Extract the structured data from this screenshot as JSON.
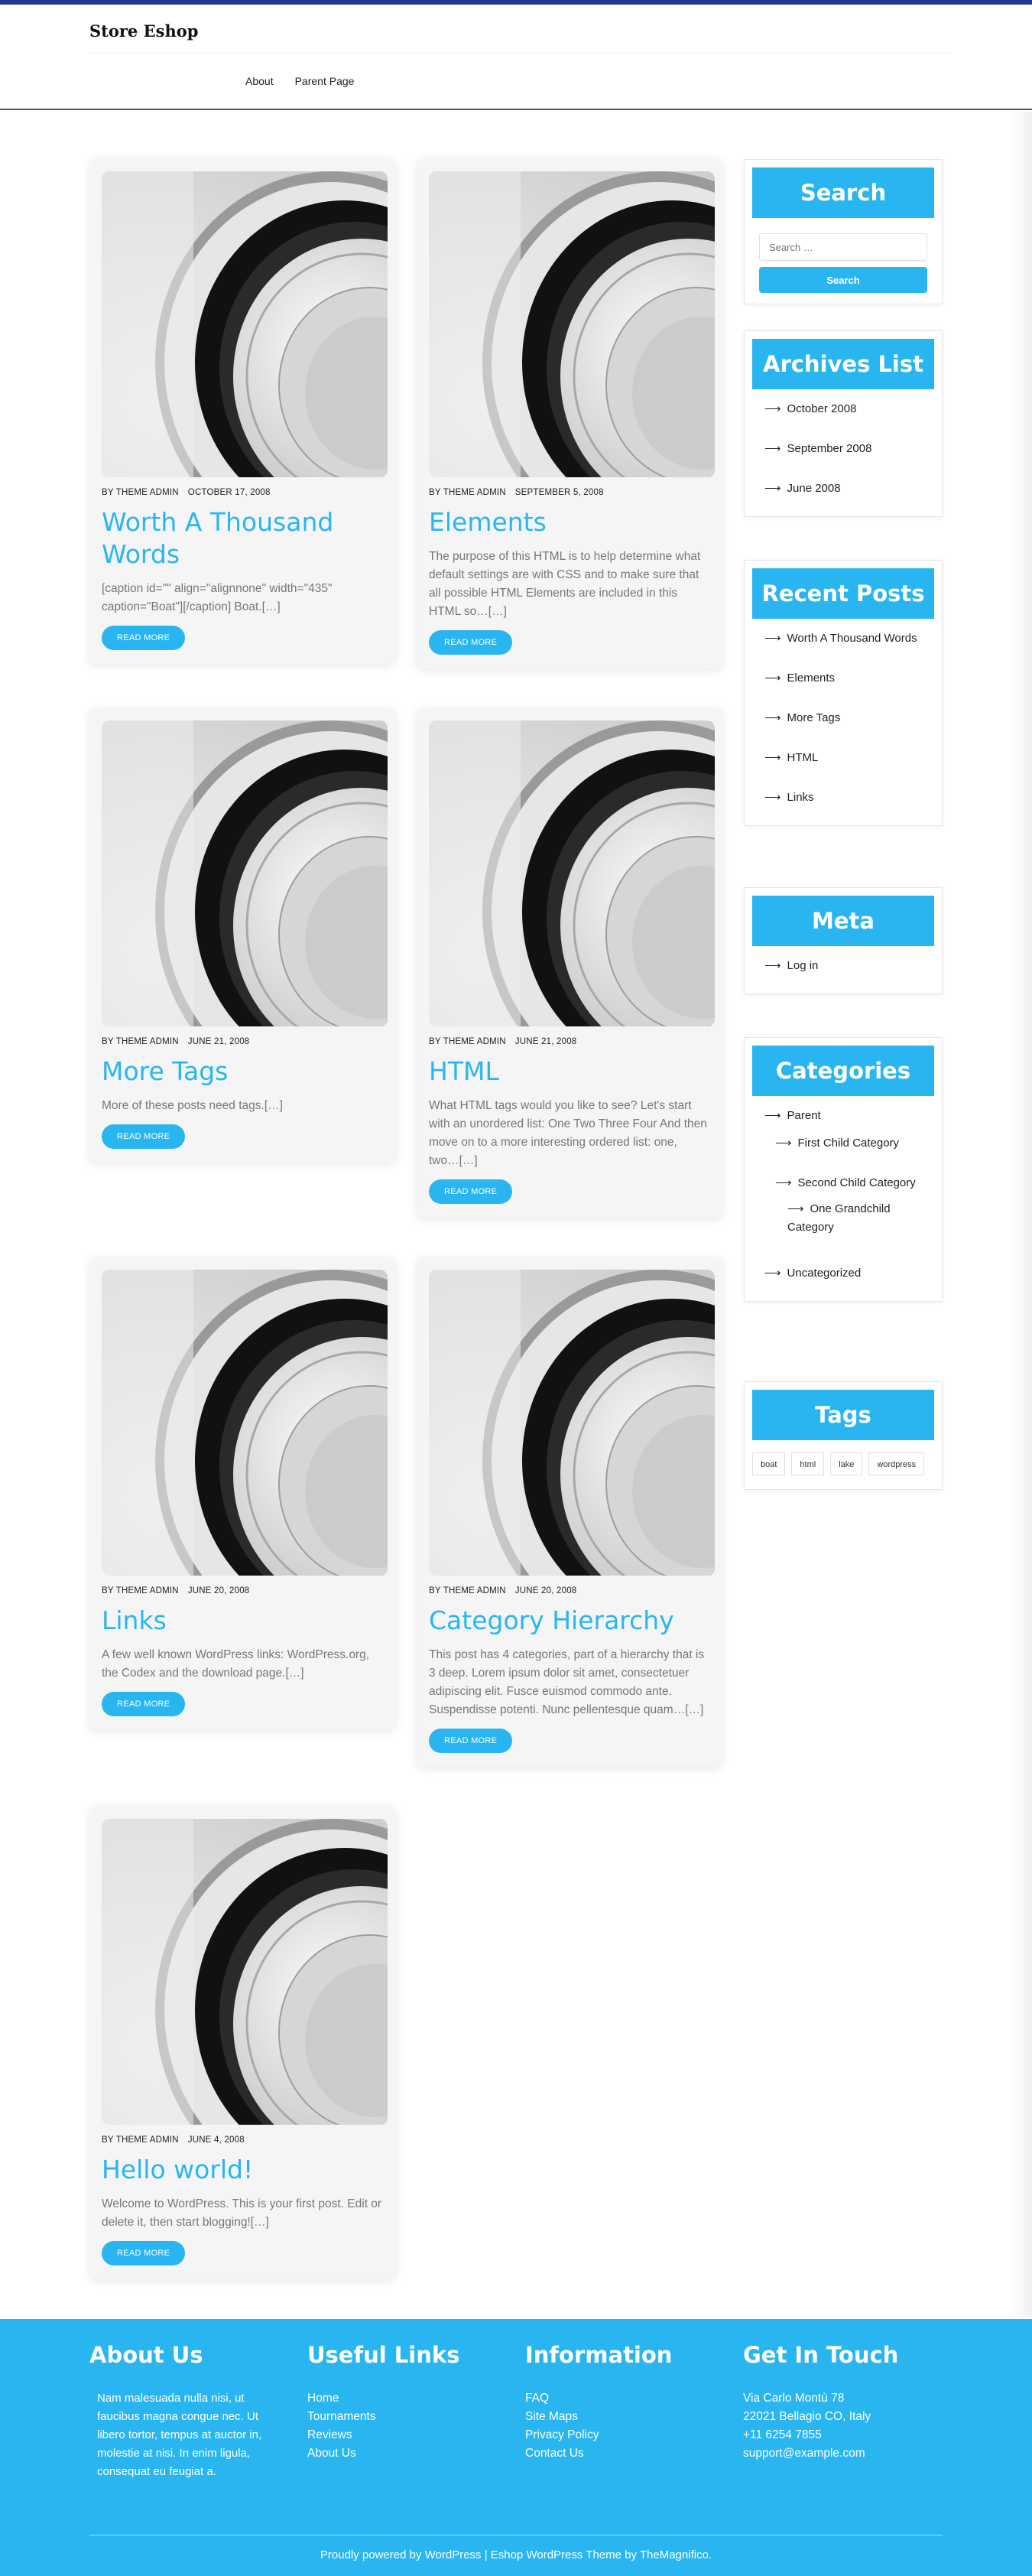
{
  "site": {
    "title": "Store Eshop"
  },
  "nav": [
    {
      "label": "About"
    },
    {
      "label": "Parent Page"
    }
  ],
  "posts": [
    {
      "author": "BY THEME ADMIN",
      "date": "OCTOBER 17, 2008",
      "title": "Worth A Thousand Words",
      "excerpt": "[caption id=\"\" align=\"alignnone\" width=\"435\" caption=\"Boat\"][/caption] Boat.[…]",
      "read_more": "READ MORE"
    },
    {
      "author": "BY THEME ADMIN",
      "date": "SEPTEMBER 5, 2008",
      "title": "Elements",
      "excerpt": "The purpose of this HTML is to help determine what default settings are with CSS and to make sure that all possible HTML Elements are included in this HTML so…[…]",
      "read_more": "READ MORE"
    },
    {
      "author": "BY THEME ADMIN",
      "date": "JUNE 21, 2008",
      "title": "More Tags",
      "excerpt": "More of these posts need tags.[…]",
      "read_more": "READ MORE"
    },
    {
      "author": "BY THEME ADMIN",
      "date": "JUNE 21, 2008",
      "title": "HTML",
      "excerpt": "What HTML tags would you like to see? Let's start with an unordered list: One Two Three Four And then move on to a more interesting ordered list: one, two…[…]",
      "read_more": "READ MORE"
    },
    {
      "author": "BY THEME ADMIN",
      "date": "JUNE 20, 2008",
      "title": "Links",
      "excerpt": "A few well known WordPress links: WordPress.org, the Codex and the download page.[…]",
      "read_more": "READ MORE"
    },
    {
      "author": "BY THEME ADMIN",
      "date": "JUNE 20, 2008",
      "title": "Category Hierarchy",
      "excerpt": "This post has 4 categories, part of a hierarchy that is 3 deep. Lorem ipsum dolor sit amet, consectetuer adipiscing elit. Fusce euismod commodo ante. Suspendisse potenti. Nunc pellentesque quam…[…]",
      "read_more": "READ MORE"
    },
    {
      "author": "BY THEME ADMIN",
      "date": "JUNE 4, 2008",
      "title": "Hello world!",
      "excerpt": "Welcome to WordPress. This is your first post. Edit or delete it, then start blogging![…]",
      "read_more": "READ MORE"
    }
  ],
  "sidebar": {
    "search": {
      "title": "Search",
      "placeholder": "Search …",
      "button": "Search"
    },
    "archives": {
      "title": "Archives List",
      "items": [
        "October 2008",
        "September 2008",
        "June 2008"
      ]
    },
    "recent": {
      "title": "Recent Posts",
      "items": [
        "Worth A Thousand Words",
        "Elements",
        "More Tags",
        "HTML",
        "Links"
      ]
    },
    "meta": {
      "title": "Meta",
      "items": [
        "Log in"
      ]
    },
    "categories": {
      "title": "Categories",
      "items": [
        "Parent",
        "First Child Category",
        "Second Child Category",
        "One Grandchild Category",
        "Uncategorized"
      ]
    },
    "tags": {
      "title": "Tags",
      "items": [
        "boat",
        "html",
        "lake",
        "wordpress"
      ]
    }
  },
  "footer": {
    "about": {
      "title": "About Us",
      "text": "Nam malesuada nulla nisi, ut faucibus magna congue nec. Ut libero tortor, tempus at auctor in, molestie at nisi. In enim ligula, consequat eu feugiat a."
    },
    "useful": {
      "title": "Useful Links",
      "items": [
        "Home",
        "Tournaments",
        "Reviews",
        "About Us"
      ]
    },
    "info": {
      "title": "Information",
      "items": [
        "FAQ",
        "Site Maps",
        "Privacy Policy",
        "Contact Us"
      ]
    },
    "contact": {
      "title": "Get In Touch",
      "items": [
        "Via Carlo Montù 78",
        "22021 Bellagio CO, Italy",
        "+11 6254 7855",
        "support@example.com"
      ]
    },
    "copyright": "Proudly powered by WordPress | Eshop WordPress Theme by TheMagnifico."
  },
  "colors": {
    "accent": "#29b6f0",
    "topbar": "#1f3a8f",
    "footer_bg": "#29b6f0"
  }
}
